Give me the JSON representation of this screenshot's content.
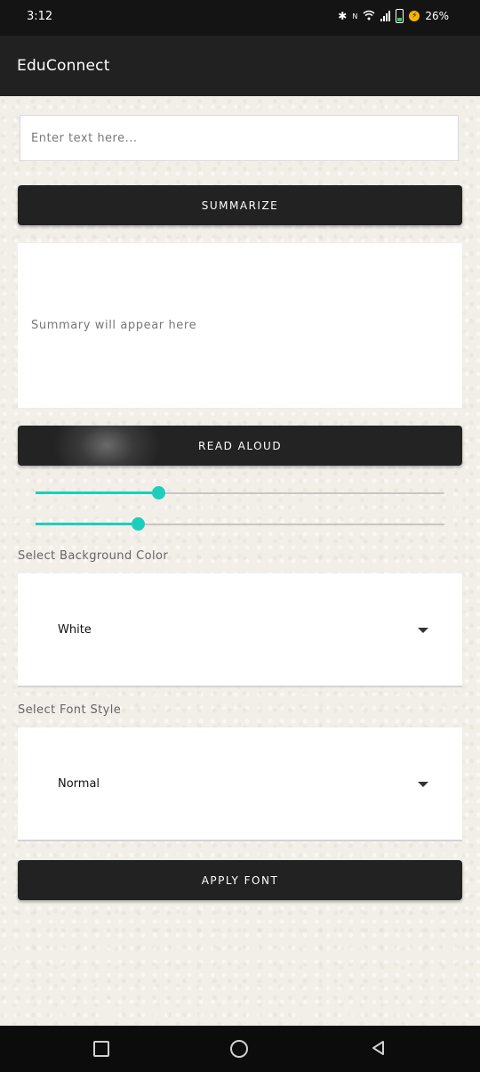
{
  "status_bar": {
    "time": "3:12",
    "battery_percent": "26%",
    "icons": [
      "bluetooth-icon",
      "nfc-icon",
      "wifi-icon",
      "signal-icon",
      "battery-icon",
      "charging-icon"
    ]
  },
  "app_bar": {
    "title": "EduConnect"
  },
  "input": {
    "placeholder": "Enter text here...",
    "value": ""
  },
  "summarize_button": {
    "label": "SUMMARIZE"
  },
  "summary": {
    "placeholder": "Summary will appear here"
  },
  "read_aloud_button": {
    "label": "READ ALOUD"
  },
  "sliders": [
    {
      "name": "slider-1",
      "value_fraction": 0.3
    },
    {
      "name": "slider-2",
      "value_fraction": 0.25
    }
  ],
  "background_color": {
    "label": "Select Background Color",
    "selected": "White"
  },
  "font_style": {
    "label": "Select Font Style",
    "selected": "Normal"
  },
  "apply_font_button": {
    "label": "APPLY FONT"
  },
  "colors": {
    "accent": "#1ccfbd",
    "button_bg": "#222222",
    "app_bar_bg": "#212121"
  },
  "nav_bar": {
    "icons": [
      "recent-apps-icon",
      "home-icon",
      "back-icon"
    ]
  }
}
